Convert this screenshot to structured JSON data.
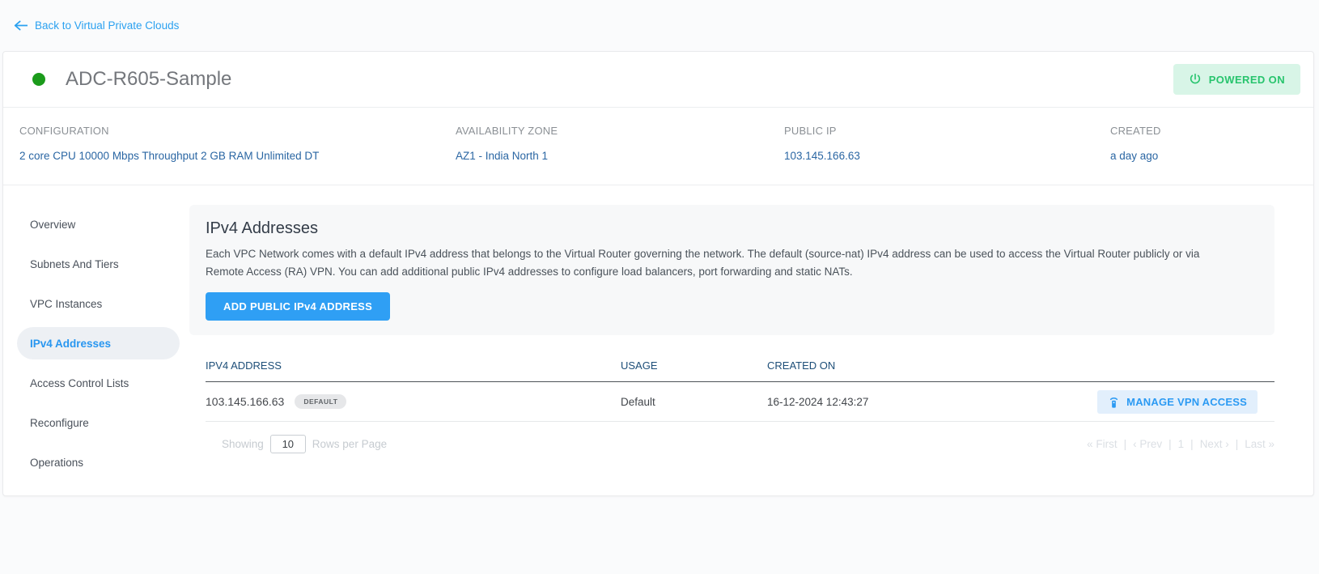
{
  "colors": {
    "accent_blue": "#2f9ff4",
    "link_blue": "#2ba1f0",
    "status_green": "#27c46d",
    "status_green_bg": "#d8f5e7",
    "dot_green": "#1b9b1b",
    "table_header_blue": "#1d4e78",
    "info_value_blue": "#2a66a3"
  },
  "back_link": {
    "label": "Back to Virtual Private Clouds",
    "icon": "arrow-left-icon"
  },
  "header": {
    "title": "ADC-R605-Sample",
    "status_badge": "POWERED ON",
    "status_icon": "power-icon"
  },
  "info": {
    "columns": [
      {
        "label": "CONFIGURATION",
        "value": "2 core CPU 10000 Mbps Throughput 2 GB RAM Unlimited DT"
      },
      {
        "label": "AVAILABILITY ZONE",
        "value": "AZ1 - India North 1"
      },
      {
        "label": "PUBLIC IP",
        "value": "103.145.166.63"
      },
      {
        "label": "CREATED",
        "value": "a day ago"
      }
    ]
  },
  "sidebar": {
    "items": [
      {
        "label": "Overview",
        "active": false
      },
      {
        "label": "Subnets And Tiers",
        "active": false
      },
      {
        "label": "VPC Instances",
        "active": false
      },
      {
        "label": "IPv4 Addresses",
        "active": true
      },
      {
        "label": "Access Control Lists",
        "active": false
      },
      {
        "label": "Reconfigure",
        "active": false
      },
      {
        "label": "Operations",
        "active": false
      }
    ]
  },
  "section": {
    "title": "IPv4 Addresses",
    "description": "Each VPC Network comes with a default IPv4 address that belongs to the Virtual Router governing the network. The default (source-nat) IPv4 address can be used to access the Virtual Router publicly or via Remote Access (RA) VPN. You can add additional public IPv4 addresses to configure load balancers, port forwarding and static NATs.",
    "add_button": "ADD PUBLIC IPv4 ADDRESS"
  },
  "table": {
    "headers": {
      "ip": "IPV4 ADDRESS",
      "usage": "USAGE",
      "created": "CREATED ON"
    },
    "rows": [
      {
        "ip": "103.145.166.63",
        "badge": "DEFAULT",
        "usage": "Default",
        "created_on": "16-12-2024 12:43:27",
        "action": "MANAGE VPN ACCESS",
        "action_icon": "vpn-remote-icon"
      }
    ]
  },
  "pagination": {
    "showing_label": "Showing",
    "rows_value": "10",
    "rows_label": "Rows per Page",
    "first": "« First",
    "prev": "‹ Prev",
    "page": "1",
    "next": "Next ›",
    "last": "Last »",
    "sep": "|"
  }
}
